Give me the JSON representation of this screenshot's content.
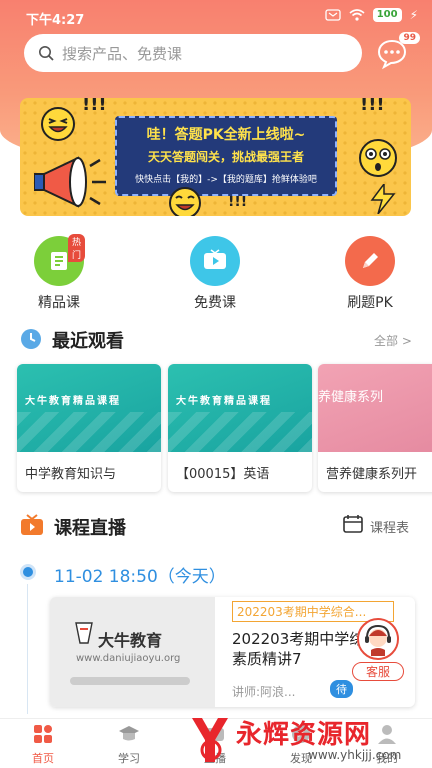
{
  "status": {
    "time": "下午4:27",
    "battery": "100"
  },
  "search": {
    "placeholder": "搜索产品、免费课"
  },
  "messages": {
    "badge": "99"
  },
  "banner": {
    "title": "哇！答题PK全新上线啦~",
    "subtitle": "天天答题闯关，挑战最强王者",
    "hint": "快快点击【我的】->【我的题库】抢鲜体验吧",
    "bangs": "!!!"
  },
  "quick": [
    {
      "label": "精品课",
      "badge": "热门",
      "color": "#7ccf3a",
      "icon": "book-icon"
    },
    {
      "label": "免费课",
      "color": "#3ec6e8",
      "icon": "tv-play-icon"
    },
    {
      "label": "刷题PK",
      "color": "#f36a4c",
      "icon": "pencil-icon"
    }
  ],
  "recent": {
    "title": "最近观看",
    "more": "全部 >",
    "items": [
      {
        "thumb": "大牛教育精品课程",
        "name": "中学教育知识与"
      },
      {
        "thumb": "大牛教育精品课程",
        "name": "【00015】英语"
      },
      {
        "thumb": "养健康系列",
        "name": "营养健康系列开"
      }
    ]
  },
  "live": {
    "title": "课程直播",
    "schedule_label": "课程表",
    "date": "11-02   18:50（今天）",
    "card": {
      "brand": "大牛教育",
      "url": "www.daniujiaoyu.org",
      "tag": "202203考期中学综合...",
      "title": "202203考期中学综合素质精讲7",
      "teacher": "讲师:阿浪...",
      "status": "待"
    }
  },
  "kefu": {
    "label": "客服"
  },
  "tabs": [
    {
      "label": "首页",
      "active": true
    },
    {
      "label": "学习",
      "active": false
    },
    {
      "label": "直播",
      "active": false
    },
    {
      "label": "发现",
      "active": false
    },
    {
      "label": "我的",
      "active": false
    }
  ],
  "watermark": {
    "text": "永辉资源网",
    "url": "www.yhkjjj.com"
  },
  "colors": {
    "accent": "#f05a46",
    "live_blue": "#2f8fe0",
    "tag_orange": "#f3a533"
  }
}
